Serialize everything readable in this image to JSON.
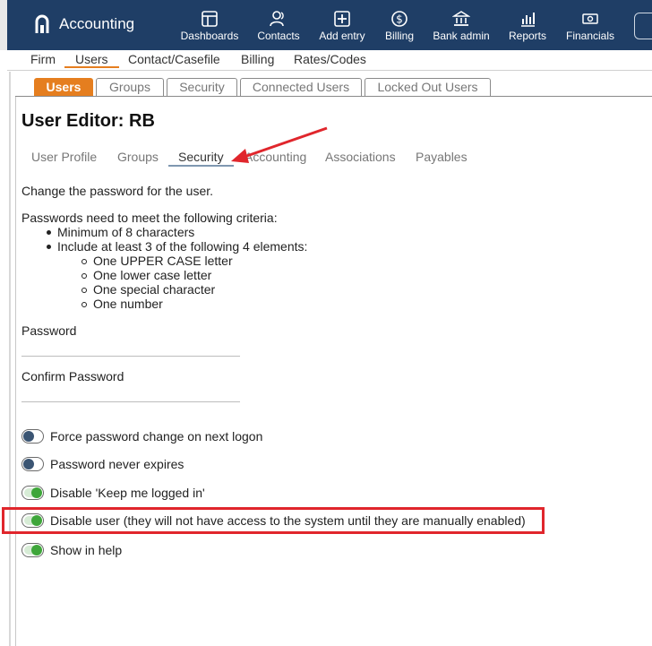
{
  "app": {
    "name": "Accounting"
  },
  "topnav": [
    {
      "label": "Dashboards",
      "icon": "dashboard-icon"
    },
    {
      "label": "Contacts",
      "icon": "contacts-icon"
    },
    {
      "label": "Add entry",
      "icon": "plus-box-icon"
    },
    {
      "label": "Billing",
      "icon": "dollar-icon"
    },
    {
      "label": "Bank admin",
      "icon": "bank-icon"
    },
    {
      "label": "Reports",
      "icon": "bar-chart-icon"
    },
    {
      "label": "Financials",
      "icon": "money-icon"
    }
  ],
  "subnav": [
    "Firm",
    "Users",
    "Contact/Casefile",
    "Billing",
    "Rates/Codes"
  ],
  "subnav_active": "Users",
  "tabs": [
    "Users",
    "Groups",
    "Security",
    "Connected Users",
    "Locked Out Users"
  ],
  "tabs_active": "Users",
  "editor": {
    "title": "User Editor: RB",
    "subtabs": [
      "User Profile",
      "Groups",
      "Security",
      "Accounting",
      "Associations",
      "Payables"
    ],
    "subtabs_active": "Security"
  },
  "security": {
    "intro": "Change the password for the user.",
    "criteria_heading": "Passwords need to meet the following criteria:",
    "criteria": [
      "Minimum of 8 characters",
      "Include at least 3 of the following 4 elements:"
    ],
    "elements": [
      "One UPPER CASE letter",
      "One lower case letter",
      "One special character",
      "One number"
    ],
    "password_label": "Password",
    "password_value": "",
    "confirm_label": "Confirm Password",
    "confirm_value": "",
    "options": [
      {
        "label": "Force password change on next logon",
        "on": false
      },
      {
        "label": "Password never expires",
        "on": false
      },
      {
        "label": "Disable 'Keep me logged in'",
        "on": true
      },
      {
        "label": "Disable user (they will not have access to the system until they are manually enabled)",
        "on": true
      },
      {
        "label": "Show in help",
        "on": true
      }
    ]
  },
  "colors": {
    "nav_bg": "#1f3e66",
    "accent": "#e57e1f",
    "toggle_on": "#3ea63a",
    "toggle_off": "#3b5573",
    "highlight": "#e0262c",
    "arrow": "#e0262c"
  }
}
